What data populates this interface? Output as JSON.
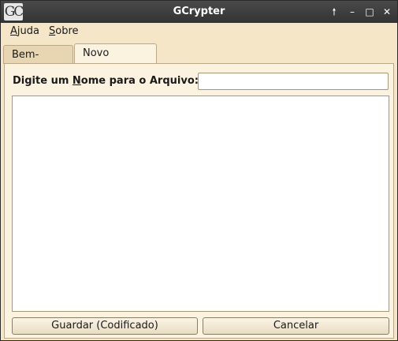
{
  "window": {
    "title": "GCrypter",
    "app_icon_text": "GC"
  },
  "window_controls": {
    "pin": "🠕",
    "minimize": "–",
    "maximize": "□",
    "close": "✕"
  },
  "menu": {
    "items": [
      {
        "label_first": "A",
        "label_rest": "juda"
      },
      {
        "label_first": "S",
        "label_rest": "obre"
      }
    ]
  },
  "tabs": [
    {
      "label": "Bem-Vindo",
      "active": false
    },
    {
      "label": "Novo Arquivo",
      "active": true
    }
  ],
  "form": {
    "label_prefix": "Digite um ",
    "label_mnemonic": "N",
    "label_suffix": "ome para o Arquivo: *",
    "name_value": "",
    "content_value": ""
  },
  "buttons": {
    "save": "Guardar (Codificado)",
    "cancel": "Cancelar"
  },
  "colors": {
    "background": "#f5e6c8",
    "titlebar": "#3a3a3a"
  }
}
